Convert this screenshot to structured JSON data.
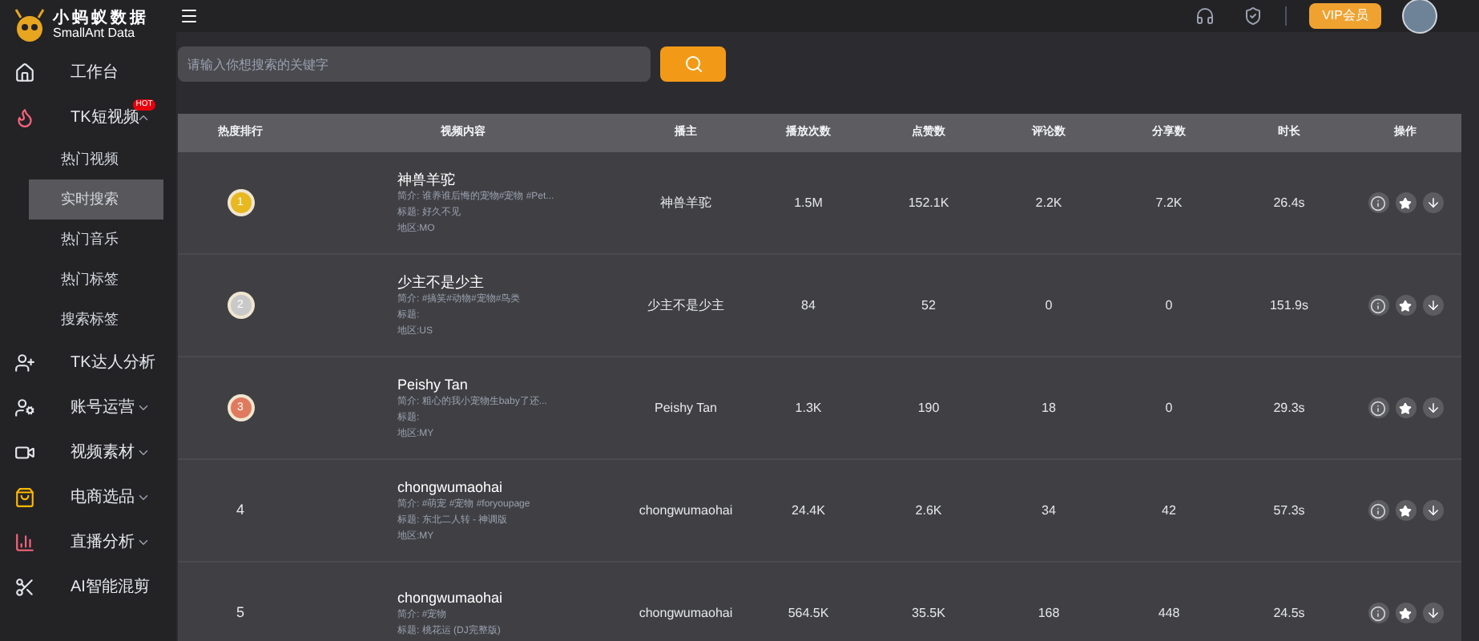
{
  "logo": {
    "title": "小蚂蚁数据",
    "subtitle": "SmallAnt Data"
  },
  "header": {
    "vip_button": "VIP会员"
  },
  "sidebar": {
    "items": [
      {
        "label": "工作台",
        "kind": "home"
      },
      {
        "label": "TK短视频",
        "kind": "fire",
        "badge": "HOT",
        "expanded": true,
        "children": [
          {
            "label": "热门视频",
            "selected": false
          },
          {
            "label": "实时搜索",
            "selected": true
          },
          {
            "label": "热门音乐",
            "selected": false
          },
          {
            "label": "热门标签",
            "selected": false
          },
          {
            "label": "搜索标签",
            "selected": false
          }
        ]
      },
      {
        "label": "TK达人分析",
        "kind": "user-star",
        "expanded": false
      },
      {
        "label": "账号运营",
        "kind": "user-gear",
        "expanded": false
      },
      {
        "label": "视频素材",
        "kind": "video",
        "expanded": false
      },
      {
        "label": "电商选品",
        "kind": "bag",
        "expanded": false
      },
      {
        "label": "直播分析",
        "kind": "bars",
        "expanded": false
      },
      {
        "label": "AI智能混剪",
        "kind": "scissors"
      }
    ]
  },
  "search": {
    "placeholder": "请输入你想搜索的关键字"
  },
  "table": {
    "columns": [
      "热度排行",
      "视频内容",
      "播主",
      "播放次数",
      "点赞数",
      "评论数",
      "分享数",
      "时长",
      "操作"
    ],
    "rows": [
      {
        "rank": "1",
        "kind": "gold",
        "title": "神兽羊驼",
        "intro": "简介: 谁养谁后悔的宠物#宠物 #Pet...",
        "label": "标题: 好久不见",
        "region": "地区:MO",
        "author": "神兽羊驼",
        "plays": "1.5M",
        "likes": "152.1K",
        "comments": "2.2K",
        "shares": "7.2K",
        "duration": "26.4s"
      },
      {
        "rank": "2",
        "kind": "silver",
        "title": "少主不是少主",
        "intro": "简介: #搞笑#动物#宠物#鸟类",
        "label": "标题:",
        "region": "地区:US",
        "author": "少主不是少主",
        "plays": "84",
        "likes": "52",
        "comments": "0",
        "shares": "0",
        "duration": "151.9s"
      },
      {
        "rank": "3",
        "kind": "bronze",
        "title": "Peishy Tan",
        "intro": "简介: 粗心的我小宠物生baby了还...",
        "label": "标题:",
        "region": "地区:MY",
        "author": "Peishy Tan",
        "plays": "1.3K",
        "likes": "190",
        "comments": "18",
        "shares": "0",
        "duration": "29.3s"
      },
      {
        "rank": "4",
        "kind": "plain",
        "title": "chongwumaohai",
        "intro": "简介: #萌宠 #宠物 #foryoupage",
        "label": "标题: 东北二人转 - 神调版",
        "region": "地区:MY",
        "author": "chongwumaohai",
        "plays": "24.4K",
        "likes": "2.6K",
        "comments": "34",
        "shares": "42",
        "duration": "57.3s"
      },
      {
        "rank": "5",
        "kind": "plain",
        "title": "chongwumaohai",
        "intro": "简介: #宠物",
        "label": "标题: 桃花运 (DJ完整版)",
        "author": "chongwumaohai",
        "plays": "564.5K",
        "likes": "35.5K",
        "comments": "168",
        "shares": "448",
        "duration": "24.5s"
      }
    ]
  }
}
